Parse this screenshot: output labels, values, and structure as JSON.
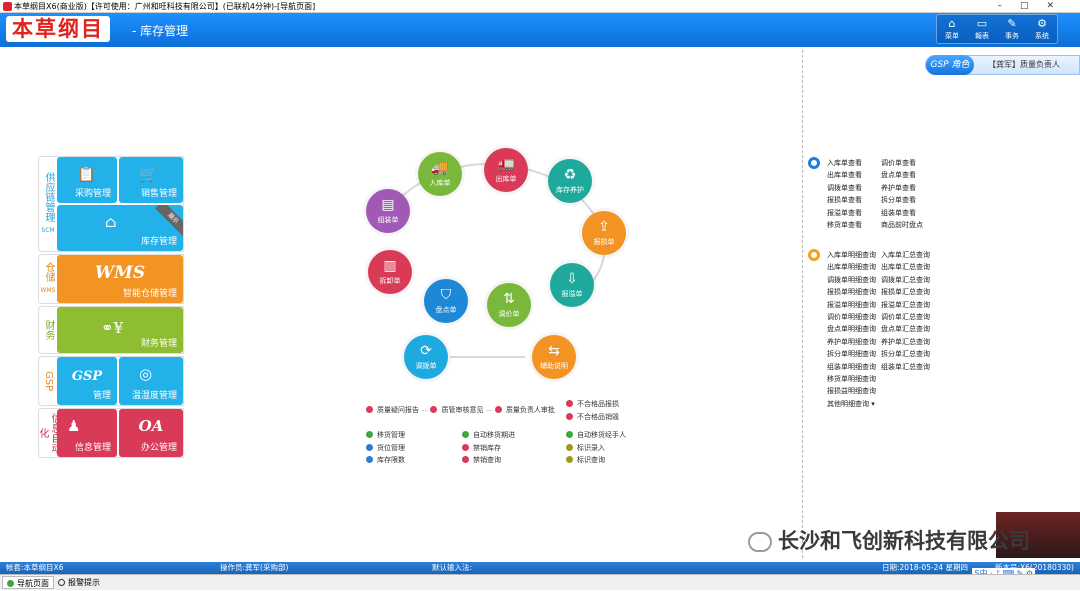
{
  "window": {
    "title": "本草纲目X6(商业版)【许可使用：广州和旺科技有限公司】(已联机4分钟)-[导航页面]",
    "controls": [
      "–",
      "□",
      "✕"
    ]
  },
  "header": {
    "logo": "本草纲目",
    "module": "- 库存管理",
    "nav": [
      {
        "icon": "⌂",
        "label": "菜单"
      },
      {
        "icon": "▭",
        "label": "報表"
      },
      {
        "icon": "✎",
        "label": "事务"
      },
      {
        "icon": "⚙",
        "label": "系统"
      }
    ]
  },
  "gsp": {
    "tag": "GSP 角色",
    "name": "【龚军】质量负责人"
  },
  "sidebar": {
    "groups": {
      "supply": {
        "label": "供应链管理",
        "sub": "SCM",
        "color": "#23b1ea"
      },
      "wms": {
        "label": "仓储",
        "sub": "WMS",
        "color": "#f39323"
      },
      "finance": {
        "label": "财务",
        "color": "#8ebd32"
      },
      "gsp": {
        "label": "GSP",
        "color": "#23b1ea"
      },
      "oa": {
        "label": "信息自动化",
        "color": "#d83a57"
      }
    },
    "tiles": {
      "purchase": "采购管理",
      "sales": "销售管理",
      "inventory": "库存管理",
      "demo": "展示",
      "wms_big": "WMS",
      "wms": "智能仓储管理",
      "finance": "财务管理",
      "gsp_big": "GSP",
      "gsp": "管理",
      "temp": "温湿度管理",
      "info": "信息管理",
      "oa_big": "OA",
      "office": "办公管理"
    }
  },
  "diagram": {
    "nodes": {
      "inbound": "入库单",
      "outbound": "出库单",
      "maintain": "库存养护",
      "report_loss": "报损单",
      "report_gain": "报溢单",
      "price_adjust": "调价单",
      "stocktake": "盘点单",
      "split": "拆卸单",
      "assemble": "组装单",
      "transfer": "调拨单",
      "aux": "辅助说明"
    },
    "flow": [
      "质量疑问报告",
      "质管审核意见",
      "质量负责人审批"
    ],
    "flow_end": [
      "不合格品报损",
      "不合格品销毁"
    ],
    "legend": {
      "col1": [
        "移货管理",
        "货位管理",
        "库存限数"
      ],
      "col2": [
        "自动移货期进",
        "禁销库存",
        "禁销查询"
      ],
      "col3": [
        "自动移货经手人",
        "标识录入",
        "标识查询"
      ]
    }
  },
  "right": {
    "group1": {
      "col1": [
        "入库单查看",
        "出库单查看",
        "调拨单查看",
        "报损单查看",
        "报溢单查看",
        "移货单查看"
      ],
      "col2": [
        "调价单查看",
        "盘点单查看",
        "养护单查看",
        "拆分单查看",
        "组装单查看",
        "商品前时盘点"
      ]
    },
    "group2": {
      "col1": [
        "入库单明细查询",
        "出库单明细查询",
        "调拨单明细查询",
        "报损单明细查询",
        "报溢单明细查询",
        "调价单明细查询",
        "盘点单明细查询",
        "养护单明细查询",
        "拆分单明细查询",
        "组装单明细查询",
        "移货单明细查询",
        "报损益明细查询",
        "其他明细查询 ▾"
      ],
      "col2": [
        "入库单汇总查询",
        "出库单汇总查询",
        "调拨单汇总查询",
        "报损单汇总查询",
        "报溢单汇总查询",
        "调价单汇总查询",
        "盘点单汇总查询",
        "养护单汇总查询",
        "拆分单汇总查询",
        "组装单汇总查询"
      ]
    }
  },
  "watermark": "长沙和飞创新科技有限公司",
  "status": {
    "account": "帐套:本草纲目X6",
    "operator": "操作员:龚军(采购部)",
    "ime": "默认输入法:",
    "date": "日期:2018-05-24 星期四",
    "version": "版本号:X6(20180330)"
  },
  "tabs": [
    "导航页面",
    "报警提示"
  ]
}
